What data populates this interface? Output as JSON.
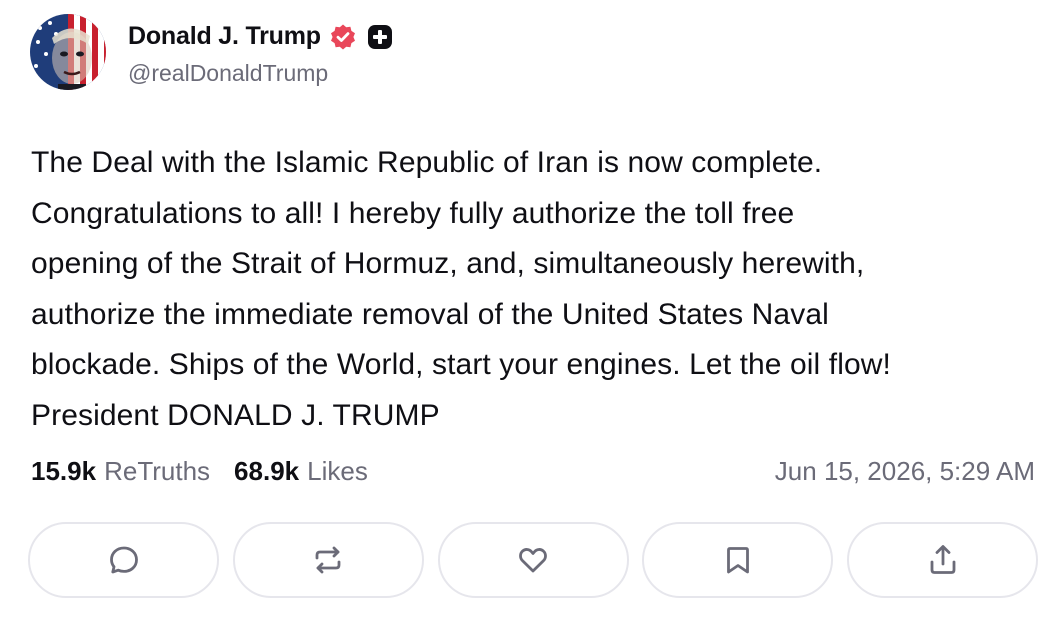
{
  "account": {
    "display_name": "Donald J. Trump",
    "handle": "@realDonaldTrump",
    "verified_icon": "verified-badge-icon",
    "extra_badge_icon": "plus-badge-icon"
  },
  "post": {
    "lines": [
      "The Deal with the Islamic Republic of Iran is now complete.",
      "Congratulations to all! I hereby fully authorize the toll free",
      "opening of the Strait of Hormuz, and, simultaneously herewith,",
      "authorize the immediate removal of the United States Naval",
      "blockade. Ships of the World, start your engines. Let the oil flow!",
      "President DONALD J. TRUMP"
    ]
  },
  "stats": {
    "retruths_count": "15.9k",
    "retruths_label": "ReTruths",
    "likes_count": "68.9k",
    "likes_label": "Likes",
    "timestamp": "Jun 15, 2026, 5:29 AM"
  },
  "actions": [
    {
      "name": "reply-button",
      "icon": "comment-icon"
    },
    {
      "name": "retruth-button",
      "icon": "repost-icon"
    },
    {
      "name": "like-button",
      "icon": "heart-icon"
    },
    {
      "name": "bookmark-button",
      "icon": "bookmark-icon"
    },
    {
      "name": "share-button",
      "icon": "share-icon"
    }
  ],
  "colors": {
    "text": "#0f0f14",
    "muted": "#6b6b78",
    "verified": "#e9475a",
    "icon": "#6b6b78",
    "border": "#e6e6ec"
  }
}
